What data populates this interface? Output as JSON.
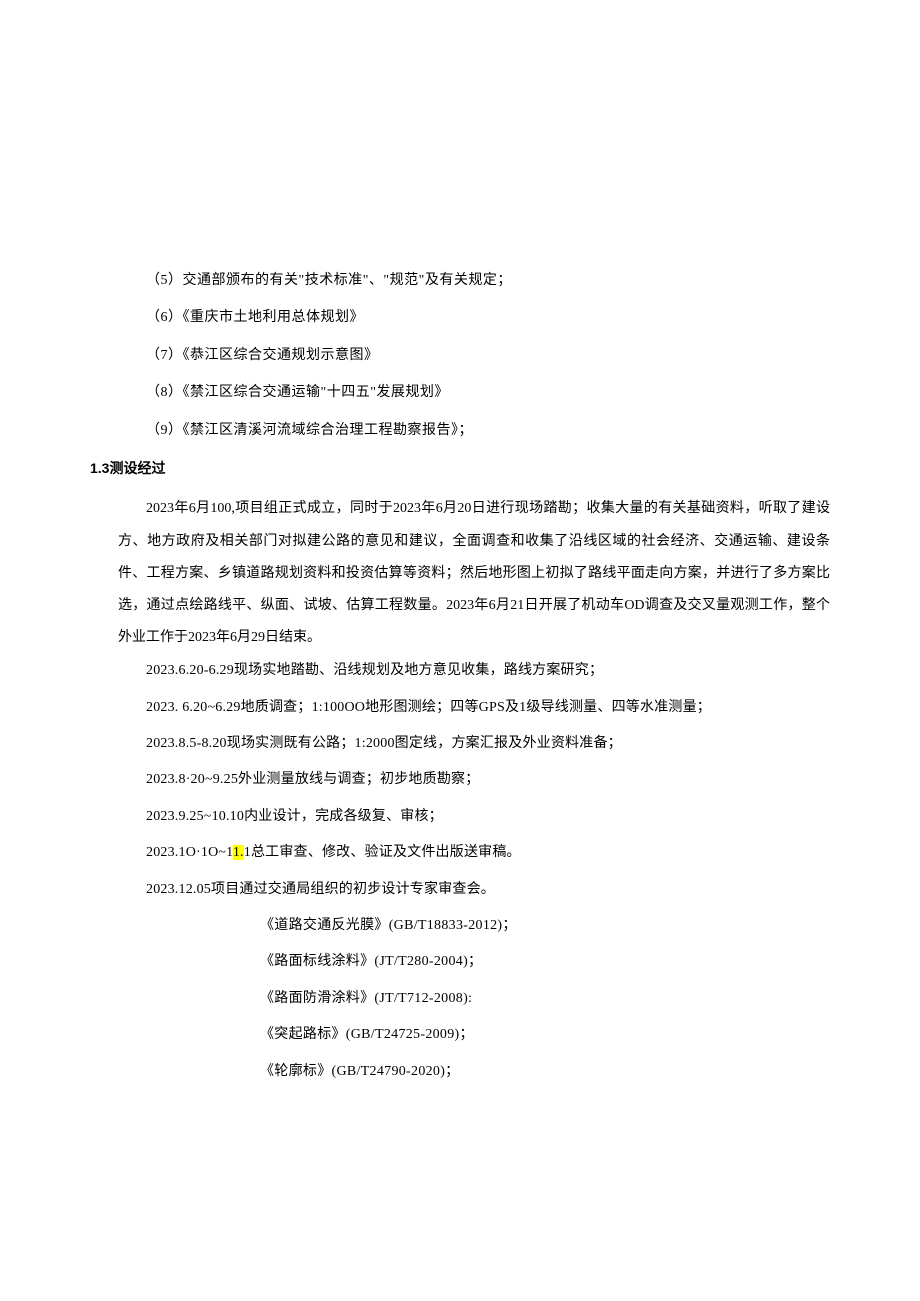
{
  "items": [
    "（5）交通部颁布的有关\"技术标准\"、\"规范\"及有关规定；",
    "（6）《重庆市土地利用总体规划》",
    "（7）《恭江区综合交通规划示意图》",
    "（8）《禁江区综合交通运输\"十四五\"发展规划》",
    "（9）《禁江区清溪河流域综合治理工程勘察报告》；"
  ],
  "heading": "1.3测设经过",
  "paragraph": "2023年6月100,项目组正式成立，同时于2023年6月20日进行现场踏勘；收集大量的有关基础资料，听取了建设方、地方政府及相关部门对拟建公路的意见和建议，全面调查和收集了沿线区域的社会经济、交通运输、建设条件、工程方案、乡镇道路规划资料和投资估算等资料；然后地形图上初拟了路线平面走向方案，并进行了多方案比选，通过点绘路线平、纵面、试坡、估算工程数量。2023年6月21日开展了机动车OD调查及交叉量观测工作，整个外业工作于2023年6月29日结束。",
  "schedule": [
    "2023.6.20-6.29现场实地踏勘、沿线规划及地方意见收集，路线方案研究；",
    "2023.   6.20~6.29地质调查；1:100OO地形图测绘；四等GPS及1级导线测量、四等水准测量；",
    "2023.8.5-8.20现场实测既有公路；1:2000图定线，方案汇报及外业资料准备；",
    "2023.8·20~9.25外业测量放线与调查；初步地质勘察；",
    "2023.9.25~10.10内业设计，完成各级复、审核；"
  ],
  "highlight_line": {
    "before": "2023.1O·1O~1",
    "hl": "1.",
    "after": "1总工审查、修改、验证及文件出版送审稿。"
  },
  "schedule_after": "2023.12.05项目通过交通局组织的初步设计专家审查会。",
  "refs": [
    "《道路交通反光膜》(GB/T18833-2012)；",
    "《路面标线涂料》(JT/T280-2004)；",
    "《路面防滑涂料》(JT/T712-2008):",
    "《突起路标》(GB/T24725-2009)；",
    "《轮廓标》(GB/T24790-2020)；"
  ]
}
